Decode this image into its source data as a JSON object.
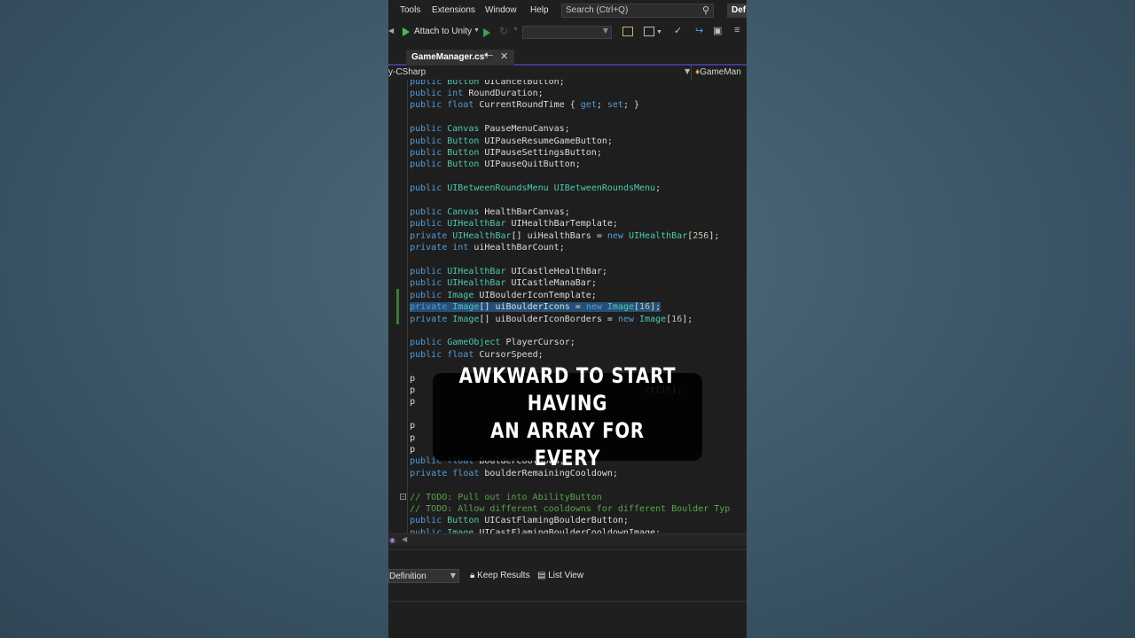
{
  "menu": {
    "items": [
      "Tools",
      "Extensions",
      "Window",
      "Help"
    ],
    "search_placeholder": "Search (Ctrl+Q)",
    "config": "Def"
  },
  "toolbar": {
    "attach_label": "Attach to Unity"
  },
  "tab": {
    "title": "GameManager.cs*"
  },
  "navbar": {
    "project": "y-CSharp",
    "member": "GameMan"
  },
  "code": [
    "    public Button UICancelButton;",
    "    public int RoundDuration;",
    "    public float CurrentRoundTime { get; set; }",
    "",
    "    public Canvas PauseMenuCanvas;",
    "    public Button UIPauseResumeGameButton;",
    "    public Button UIPauseSettingsButton;",
    "    public Button UIPauseQuitButton;",
    "",
    "    public UIBetweenRoundsMenu UIBetweenRoundsMenu;",
    "",
    "    public Canvas HealthBarCanvas;",
    "    public UIHealthBar UIHealthBarTemplate;",
    "    private UIHealthBar[] uiHealthBars = new UIHealthBar[256];",
    "    private int uiHealthBarCount;",
    "",
    "    public UIHealthBar UICastleHealthBar;",
    "    public UIHealthBar UICastleManaBar;",
    "    public Image UIBoulderIconTemplate;",
    "    private Image[] uiBoulderIcons = new Image[16];",
    "    private Image[] uiBoulderIconBorders = new Image[16];",
    "",
    "    public GameObject PlayerCursor;",
    "    public float CursorSpeed;",
    "",
    "    p",
    "    p                                           ct[16];",
    "    p",
    "",
    "    p",
    "    p",
    "    p",
    "    public float BoulderCooldown;",
    "    private float boulderRemainingCooldown;",
    "",
    "    // TODO: Pull out into AbilityButton",
    "    // TODO: Allow different cooldowns for different Boulder Typ",
    "    public Button UICastFlamingBoulderButton;",
    "    public Image UICastFlamingBoulderCooldownImage;"
  ],
  "panel": {
    "definition": "Definition",
    "keep_results": "Keep Results",
    "list_view": "List View"
  },
  "caption": {
    "line1": "AWKWARD TO START HAVING",
    "line2": "AN ARRAY FOR EVERY"
  },
  "colors": {
    "keyword": "#569cd6",
    "type": "#4ec9b0",
    "number": "#b5cea8",
    "comment": "#57a64a",
    "selection": "#264f78"
  }
}
